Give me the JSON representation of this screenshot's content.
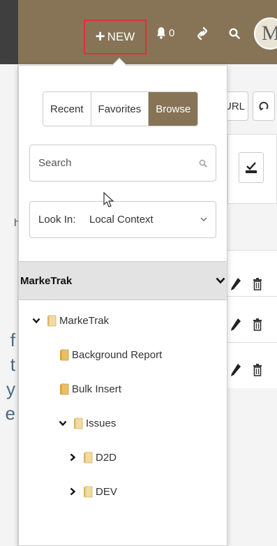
{
  "topbar": {
    "new_label": "NEW",
    "notification_count": "0",
    "avatar_letter": "M",
    "brand_color": "#877456"
  },
  "background": {
    "url_label": "URL",
    "partial_text": "h",
    "partial_letters": [
      "f",
      "t",
      "y",
      "e"
    ]
  },
  "panel": {
    "tabs": [
      {
        "label": "Recent",
        "active": false
      },
      {
        "label": "Favorites",
        "active": false
      },
      {
        "label": "Browse",
        "active": true
      }
    ],
    "search_placeholder": "Search",
    "look_in_label": "Look In:",
    "look_in_value": "Local Context",
    "tree_root": "MarkeTrak",
    "tree": [
      {
        "label": "MarkeTrak",
        "expanded": true
      },
      {
        "label": "Background Report"
      },
      {
        "label": "Bulk Insert"
      },
      {
        "label": "Issues",
        "expanded": true
      },
      {
        "label": "D2D",
        "expanded": false
      },
      {
        "label": "DEV",
        "expanded": false
      }
    ]
  }
}
